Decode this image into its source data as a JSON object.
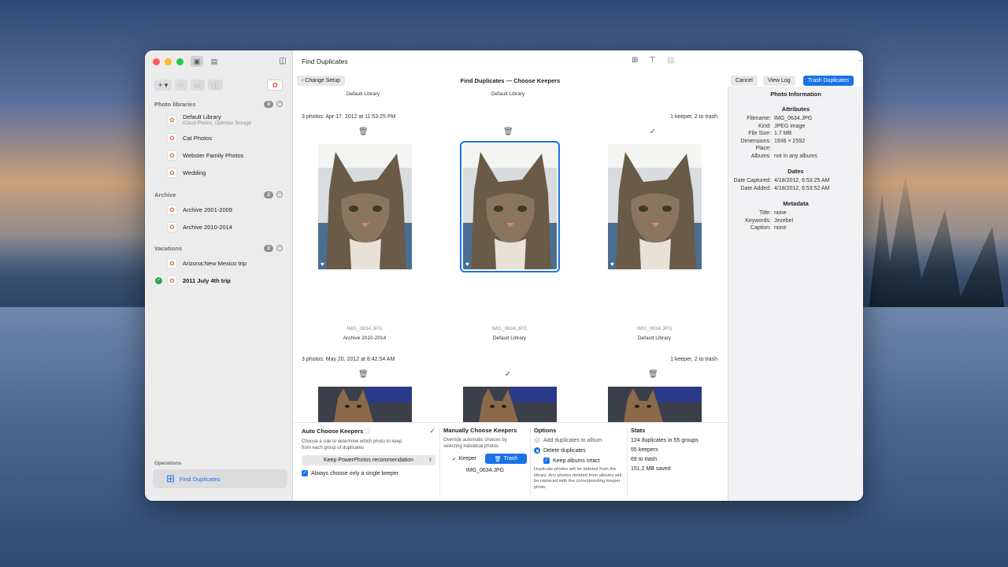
{
  "toolbar": {
    "title": "Find Duplicates"
  },
  "subheader": {
    "back_label": "Change Setup",
    "title": "Find Duplicates — Choose Keepers",
    "cancel": "Cancel",
    "view_log": "View Log",
    "trash": "Trash Duplicates"
  },
  "sidebar": {
    "photo_libraries": {
      "label": "Photo libraries",
      "count": "4",
      "items": [
        {
          "name": "Default Library",
          "sub": "iCloud Photos, Optimize Storage"
        },
        {
          "name": "Cat Photos"
        },
        {
          "name": "Webster Family Photos"
        },
        {
          "name": "Wedding"
        }
      ]
    },
    "archive": {
      "label": "Archive",
      "count": "2",
      "items": [
        {
          "name": "Archive 2001-2009"
        },
        {
          "name": "Archive 2010-2014"
        }
      ]
    },
    "vacations": {
      "label": "Vacations",
      "count": "2",
      "items": [
        {
          "name": "Arizona:New Mexico trip"
        },
        {
          "name": "2011 July 4th trip"
        }
      ]
    },
    "operations": {
      "label": "Operations",
      "item": "Find Duplicates"
    }
  },
  "grid": {
    "top_labels": [
      "Default Library",
      "Default Library"
    ],
    "group1": {
      "header": "3 photos: Apr 17, 2012 at 11:53:25 PM",
      "summary": "1 keeper, 2 to trash",
      "photos": [
        {
          "file": "IMG_0634.JPG",
          "library": "Archive 2010-2014"
        },
        {
          "file": "IMG_0634.JPG",
          "library": "Default Library"
        },
        {
          "file": "IMG_0634.JPG",
          "library": "Default Library"
        }
      ]
    },
    "group2": {
      "header": "3 photos: May 20, 2012 at 8:42:54 AM",
      "summary": "1 keeper, 2 to trash"
    }
  },
  "auto_choose": {
    "title": "Auto Choose Keepers",
    "desc": "Choose a rule to determine which photo to keep from each group of duplicates",
    "rule": "Keep PowerPhotos recommendation",
    "single": "Always choose only a single keeper"
  },
  "manual_choose": {
    "title": "Manually Choose Keepers",
    "desc": "Override automatic choices by selecting individual photos",
    "keeper": "Keeper",
    "trash": "Trash",
    "file": "IMG_0634.JPG"
  },
  "options": {
    "title": "Options",
    "add_to_album": "Add duplicates to album",
    "delete": "Delete duplicates",
    "keep_albums": "Keep albums intact",
    "note": "Duplicate photos will be deleted from the library. Any photos deleted from albums will be replaced with the corresponding keeper photo."
  },
  "stats": {
    "title": "Stats",
    "lines": [
      "124 duplicates in 55 groups",
      "55 keepers",
      "69 to trash",
      "151.2 MB saved"
    ]
  },
  "info": {
    "title": "Photo Information",
    "attributes_title": "Attributes",
    "attributes": [
      {
        "k": "Filename:",
        "v": "IMG_0634.JPG"
      },
      {
        "k": "Kind:",
        "v": "JPEG image"
      },
      {
        "k": "File Size:",
        "v": "1.7 MB"
      },
      {
        "k": "Dimensions:",
        "v": "1936 × 2592"
      },
      {
        "k": "Place:",
        "v": ""
      },
      {
        "k": "Albums:",
        "v": "not in any albums"
      }
    ],
    "dates_title": "Dates",
    "dates": [
      {
        "k": "Date Captured:",
        "v": "4/18/2012, 6:53:25 AM"
      },
      {
        "k": "Date Added:",
        "v": "4/18/2012, 6:53:52 AM"
      }
    ],
    "metadata_title": "Metadata",
    "metadata": [
      {
        "k": "Title:",
        "v": "none"
      },
      {
        "k": "Keywords:",
        "v": "Jezebel"
      },
      {
        "k": "Caption:",
        "v": "none"
      }
    ]
  },
  "colors": {
    "accent": "#1a73e8",
    "sidebar_bg": "#ececed",
    "info_bg": "#f2f2f4"
  }
}
